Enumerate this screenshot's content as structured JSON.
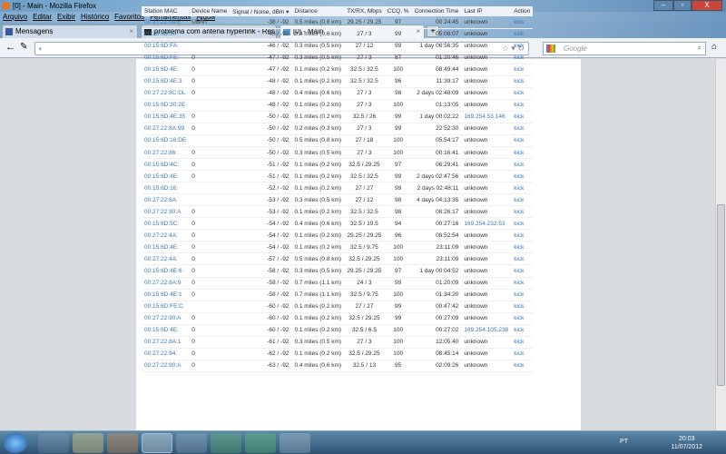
{
  "window": {
    "title": "[0] - Main - Mozilla Firefox",
    "min": "–",
    "max": "▫",
    "close": "X"
  },
  "menu": [
    "Arquivo",
    "Editar",
    "Exibir",
    "Histórico",
    "Favoritos",
    "Ferramentas",
    "Ajuda"
  ],
  "tabs": [
    {
      "label": "Mensagens",
      "icon": "facebook-icon"
    },
    {
      "label": "problema com antena hyperlink - Res...",
      "icon": "forum-icon"
    },
    {
      "label": "[0] - Main",
      "icon": "rss-icon",
      "active": true
    }
  ],
  "nav": {
    "url": "",
    "search_placeholder": "Google"
  },
  "table": {
    "headers": [
      "Station MAC",
      "Device Name",
      "Signal / Noise, dBm ▾",
      "Distance",
      "TX/RX, Mbps",
      "CCQ, %",
      "Connection Time",
      "Last IP",
      "Action"
    ],
    "rows": [
      [
        "00:27:22:00:E",
        "UBNT",
        "-38 / -92",
        "0.5 miles (0.8 km)",
        "29.25 / 29.25",
        "97",
        "00:24:45",
        "unknown",
        "kick"
      ],
      [
        "00:15:6D:30:",
        "",
        "-45 / -92",
        "0.4 miles (0.6 km)",
        "27 / 3",
        "99",
        "05:08:07",
        "unknown",
        "kick"
      ],
      [
        "00:15:6D:FA:",
        "",
        "-46 / -92",
        "0.3 miles (0.5 km)",
        "27 / 12",
        "99",
        "1 day 06:56:35",
        "unknown",
        "kick"
      ],
      [
        "00:15:6D:FE:",
        "0",
        "-47 / -92",
        "0.3 miles (0.5 km)",
        "27 / 3",
        "87",
        "01:20:46",
        "unknown",
        "kick"
      ],
      [
        "00:15:6D:4E:",
        "0",
        "-47 / -92",
        "0.1 miles (0.2 km)",
        "32.5 / 32.5",
        "100",
        "08:49:44",
        "unknown",
        "kick"
      ],
      [
        "00:15:6D:4E:3",
        "0",
        "-48 / -92",
        "0.1 miles (0.2 km)",
        "32.5 / 32.5",
        "96",
        "11:39:17",
        "unknown",
        "kick"
      ],
      [
        "00:27:22:8C:DL",
        "0",
        "-48 / -92",
        "0.4 miles (0.6 km)",
        "27 / 3",
        "98",
        "2 days 02:48:09",
        "unknown",
        "kick"
      ],
      [
        "00:15:6D:30:2E",
        "",
        "-48 / -92",
        "0.1 miles (0.2 km)",
        "27 / 3",
        "100",
        "01:13:05",
        "unknown",
        "kick"
      ],
      [
        "00:15:6D:4E:35",
        "0",
        "-50 / -92",
        "0.1 miles (0.2 km)",
        "32.5 / 26",
        "99",
        "1 day 00:02:22",
        "169.254.53.146",
        "kick"
      ],
      [
        "00:27:22:8A:99",
        "0",
        "-50 / -92",
        "0.2 miles (0.3 km)",
        "27 / 3",
        "99",
        "22:52:30",
        "unknown",
        "kick"
      ],
      [
        "00:15:6D:16:DE",
        "",
        "-50 / -92",
        "0.5 miles (0.8 km)",
        "27 / 18",
        "100",
        "05:54:17",
        "unknown",
        "kick"
      ],
      [
        "00:27:22:86:",
        "0",
        "-50 / -92",
        "0.3 miles (0.5 km)",
        "27 / 3",
        "100",
        "00:16:41",
        "unknown",
        "kick"
      ],
      [
        "00:15:6D:4C:",
        "0",
        "-51 / -92",
        "0.1 miles (0.2 km)",
        "32.5 / 29.25",
        "97",
        "06:29:41",
        "unknown",
        "kick"
      ],
      [
        "00:15:6D:4E:",
        "0",
        "-51 / -92",
        "0.1 miles (0.2 km)",
        "32.5 / 32.5",
        "99",
        "2 days 02:47:56",
        "unknown",
        "kick"
      ],
      [
        "00:15:6D:16:",
        "",
        "-52 / -92",
        "0.1 miles (0.2 km)",
        "27 / 27",
        "99",
        "2 days 02:48:11",
        "unknown",
        "kick"
      ],
      [
        "00:27:22:8A:",
        "",
        "-53 / -92",
        "0.3 miles (0.5 km)",
        "27 / 12",
        "98",
        "4 days 04:13:35",
        "unknown",
        "kick"
      ],
      [
        "00:27:22:90:A",
        "0",
        "-53 / -92",
        "0.1 miles (0.2 km)",
        "32.5 / 32.5",
        "98",
        "08:26:17",
        "unknown",
        "kick"
      ],
      [
        "00:15:6D:5C:",
        "0",
        "-54 / -92",
        "0.4 miles (0.6 km)",
        "32.5 / 19.5",
        "94",
        "00:27:16",
        "169.254.232.53",
        "kick"
      ],
      [
        "00:27:22:4A:",
        "0",
        "-54 / -92",
        "0.1 miles (0.2 km)",
        "29.25 / 29.25",
        "96",
        "08:52:54",
        "unknown",
        "kick"
      ],
      [
        "00:15:6D:4E:",
        "0",
        "-54 / -92",
        "0.1 miles (0.2 km)",
        "32.5 / 9.75",
        "100",
        "23:11:09",
        "unknown",
        "kick"
      ],
      [
        "00:27:22:4A:",
        "0",
        "-57 / -92",
        "0.5 miles (0.8 km)",
        "32.5 / 29.25",
        "100",
        "23:11:09",
        "unknown",
        "kick"
      ],
      [
        "00:15:6D:4E:6",
        "0",
        "-58 / -92",
        "0.3 miles (0.5 km)",
        "29.25 / 29.25",
        "97",
        "1 day 00:04:52",
        "unknown",
        "kick"
      ],
      [
        "00:27:22:8A:9",
        "0",
        "-58 / -92",
        "0.7 miles (1.1 km)",
        "24 / 3",
        "99",
        "01:20:09",
        "unknown",
        "kick"
      ],
      [
        "00:15:6D:4E:1",
        "0",
        "-58 / -92",
        "0.7 miles (1.1 km)",
        "32.5 / 9.75",
        "100",
        "01:34:20",
        "unknown",
        "kick"
      ],
      [
        "00:15:6D:FE:C",
        "",
        "-60 / -92",
        "0.1 miles (0.2 km)",
        "27 / 27",
        "99",
        "00:47:42",
        "unknown",
        "kick"
      ],
      [
        "00:27:22:90:A",
        "0",
        "-60 / -92",
        "0.1 miles (0.2 km)",
        "32.5 / 29.25",
        "99",
        "00:27:09",
        "unknown",
        "kick"
      ],
      [
        "00:15:6D:4E:",
        "0",
        "-60 / -92",
        "0.1 miles (0.2 km)",
        "32.5 / 6.5",
        "100",
        "00:27:02",
        "169.254.105.238",
        "kick"
      ],
      [
        "00:27:22:8A:1",
        "0",
        "-61 / -92",
        "0.3 miles (0.5 km)",
        "27 / 3",
        "100",
        "12:05:40",
        "unknown",
        "kick"
      ],
      [
        "00:27:22:94:",
        "0",
        "-62 / -92",
        "0.1 miles (0.2 km)",
        "32.5 / 29.25",
        "100",
        "08:45:14",
        "unknown",
        "kick"
      ],
      [
        "00:27:22:90:A",
        "0",
        "-63 / -92",
        "0.4 miles (0.6 km)",
        "32.5 / 13",
        "95",
        "02:09:26",
        "unknown",
        "kick"
      ]
    ]
  },
  "taskbar": {
    "lang": "PT",
    "time": "20:03",
    "date": "11/07/2012",
    "apps": [
      "start-button",
      "internet-explorer",
      "file-explorer",
      "media-player",
      "firefox",
      "app-5",
      "app-6",
      "app-7",
      "app-8"
    ]
  },
  "colors": {
    "link": "#3a78b5",
    "header_bg": "#eef1f5"
  }
}
